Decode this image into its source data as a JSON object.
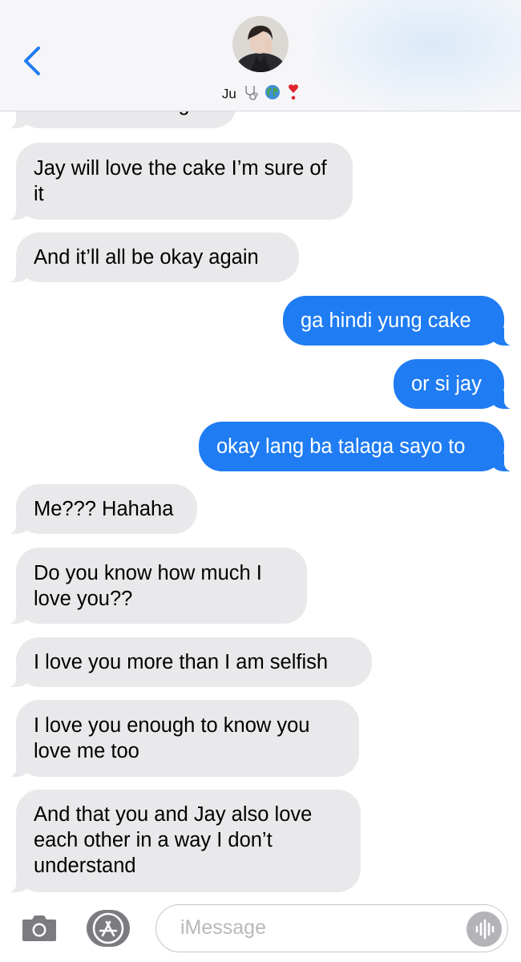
{
  "header": {
    "contact_name": "Ju",
    "emoji_icons": [
      "stethoscope-emoji",
      "globe-emoji",
      "heart-exclamation-emoji"
    ]
  },
  "messages": [
    {
      "type": "received",
      "text": "You can do this ga"
    },
    {
      "type": "received",
      "text": "Jay will love the cake I’m sure of it"
    },
    {
      "type": "received",
      "text": "And it’ll all be okay again"
    },
    {
      "type": "sent",
      "text": "ga hindi yung cake"
    },
    {
      "type": "sent",
      "text": "or si jay"
    },
    {
      "type": "sent",
      "text": "okay lang ba talaga sayo to"
    },
    {
      "type": "received",
      "text": "Me??? Hahaha"
    },
    {
      "type": "received",
      "text": "Do you know how much I love you??"
    },
    {
      "type": "received",
      "text": "I love you more than I am selfish"
    },
    {
      "type": "received",
      "text": "I love you enough to know you love me too"
    },
    {
      "type": "received",
      "text": "And that you and Jay also love each other in a way I don’t understand"
    }
  ],
  "composer": {
    "placeholder": "iMessage"
  },
  "colors": {
    "sent_bubble": "#1f7cf2",
    "received_bubble": "#e9e9eb",
    "accent": "#1f7cf2"
  }
}
